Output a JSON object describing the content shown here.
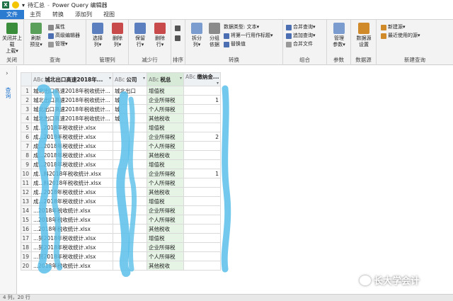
{
  "titlebar": {
    "excel_icon": "X",
    "qat_save_glyph": "▾",
    "doc_name": "待汇总",
    "separator": "-",
    "app_name": "Power Query 编辑器"
  },
  "tabs": [
    {
      "label": "文件"
    },
    {
      "label": "主页"
    },
    {
      "label": "转换"
    },
    {
      "label": "添加列"
    },
    {
      "label": "视图"
    }
  ],
  "ribbon": {
    "close": {
      "btn": "关闭并上载",
      "btn2": "上载▾",
      "group": "关闭"
    },
    "query": {
      "refresh": "刷新",
      "preview": "预览▾",
      "props": "属性",
      "adv": "高级编辑器",
      "manage": "管理▾",
      "group": "查询"
    },
    "cols": {
      "choose": "选择",
      "choose2": "列▾",
      "delete": "删除",
      "delete2": "列▾",
      "group": "管理列"
    },
    "rows": {
      "keep": "保留",
      "keep2": "行▾",
      "remove": "删除",
      "remove2": "行▾",
      "group": "减少行"
    },
    "sort": {
      "group": "排序"
    },
    "transform": {
      "split": "拆分",
      "split2": "列▾",
      "groupby": "分组",
      "groupby2": "依据",
      "dtype": "数据类型: 文本▾",
      "firstrow": "将第一行用作标题▾",
      "replace": "替换值",
      "group": "转换"
    },
    "combine": {
      "merge": "合并查询▾",
      "append": "追加查询▾",
      "mergefile": "合并文件",
      "group": "组合"
    },
    "params": {
      "manage": "管理",
      "manage2": "参数▾",
      "group": "参数"
    },
    "datasource": {
      "settings": "数据源",
      "settings2": "设置",
      "group": "数据源"
    },
    "newquery": {
      "new": "新建源▾",
      "recent": "最近使用的源▾",
      "group": "新建查询"
    }
  },
  "query_pane": {
    "toggle": "›",
    "label": "查询"
  },
  "grid": {
    "headers": [
      {
        "type": "ABc",
        "label": "城北出口高速2018年..."
      },
      {
        "type": "ABc",
        "label": "公司"
      },
      {
        "type": "ABc",
        "label": "税总"
      },
      {
        "type": "ABc",
        "label": "缴纳金..."
      }
    ],
    "rows": [
      {
        "n": "1",
        "c1": "城北出口高速2018年税收统计...",
        "c2": "城北出口",
        "c3": "增值税",
        "c4": ""
      },
      {
        "n": "2",
        "c1": "城北出口高速2018年税收统计...",
        "c2": "城",
        "c3": "企业所得税",
        "c4": "1"
      },
      {
        "n": "3",
        "c1": "城北出口高速2018年税收统计...",
        "c2": "城",
        "c3": "个人所得税",
        "c4": ""
      },
      {
        "n": "4",
        "c1": "城北出口高速2018年税收统计...",
        "c2": "城",
        "c3": "其他税收",
        "c4": ""
      },
      {
        "n": "5",
        "c1": "成...2018年税收统计.xlsx",
        "c2": "",
        "c3": "增值税",
        "c4": ""
      },
      {
        "n": "6",
        "c1": "成...2018年税收统计.xlsx",
        "c2": "",
        "c3": "企业所得税",
        "c4": "2"
      },
      {
        "n": "7",
        "c1": "成...2018年税收统计.xlsx",
        "c2": "",
        "c3": "个人所得税",
        "c4": ""
      },
      {
        "n": "8",
        "c1": "成...2018年税收统计.xlsx",
        "c2": "",
        "c3": "其他税收",
        "c4": ""
      },
      {
        "n": "9",
        "c1": "成...2018年税收统计.xlsx",
        "c2": "",
        "c3": "增值税",
        "c4": ""
      },
      {
        "n": "10",
        "c1": "成...料2018年税收统计.xlsx",
        "c2": "",
        "c3": "企业所得税",
        "c4": "1"
      },
      {
        "n": "11",
        "c1": "成...料2018年税收统计.xlsx",
        "c2": "",
        "c3": "个人所得税",
        "c4": ""
      },
      {
        "n": "12",
        "c1": "成...2018年税收统计.xlsx",
        "c2": "",
        "c3": "其他税收",
        "c4": ""
      },
      {
        "n": "13",
        "c1": "成...2018年税收统计.xlsx",
        "c2": "",
        "c3": "增值税",
        "c4": ""
      },
      {
        "n": "14",
        "c1": "...2018年税收统计.xlsx",
        "c2": "",
        "c3": "企业所得税",
        "c4": ""
      },
      {
        "n": "15",
        "c1": "...2018年税收统计.xlsx",
        "c2": "",
        "c3": "个人所得税",
        "c4": ""
      },
      {
        "n": "16",
        "c1": "...2018年税收统计.xlsx",
        "c2": "",
        "c3": "其他税收",
        "c4": ""
      },
      {
        "n": "17",
        "c1": "...贸2018年税收统计.xlsx",
        "c2": "",
        "c3": "增值税",
        "c4": ""
      },
      {
        "n": "18",
        "c1": "...贸2018年税收统计.xlsx",
        "c2": "",
        "c3": "企业所得税",
        "c4": ""
      },
      {
        "n": "19",
        "c1": "...贸2018年税收统计.xlsx",
        "c2": "",
        "c3": "个人所得税",
        "c4": ""
      },
      {
        "n": "20",
        "c1": "...2018年税收统计.xlsx",
        "c2": "",
        "c3": "其他税收",
        "c4": ""
      }
    ]
  },
  "status": {
    "text": "4 列，20 行"
  },
  "watermark": {
    "text": "长大学会计"
  },
  "colors": {
    "file_tab": "#2b7bd0",
    "scribble": "#5bbfea",
    "tax_col": "#e6f4e6"
  }
}
